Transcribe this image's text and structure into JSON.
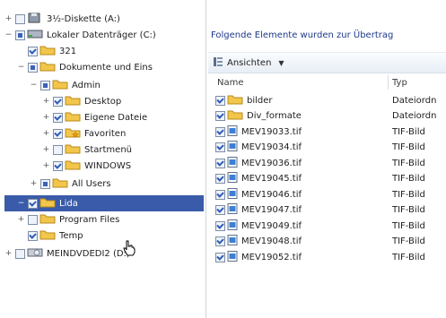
{
  "tree": {
    "items": [
      {
        "label": "3½-Diskette (A:)",
        "expand": "+",
        "check": "none",
        "icon": "floppy-drive-icon"
      },
      {
        "label": "Lokaler Datenträger (C:)",
        "expand": "−",
        "check": "partial",
        "icon": "hard-drive-icon"
      },
      {
        "label": "321",
        "expand": "",
        "check": "checked",
        "icon": "folder-icon"
      },
      {
        "label": "Dokumente und Eins",
        "expand": "−",
        "check": "partial",
        "icon": "folder-icon"
      },
      {
        "label": "Admin",
        "expand": "−",
        "check": "partial",
        "icon": "folder-icon"
      },
      {
        "label": "Desktop",
        "expand": "+",
        "check": "checked",
        "icon": "folder-icon"
      },
      {
        "label": "Eigene Dateie",
        "expand": "+",
        "check": "checked",
        "icon": "folder-icon"
      },
      {
        "label": "Favoriten",
        "expand": "+",
        "check": "checked",
        "icon": "favorites-folder-icon"
      },
      {
        "label": "Startmenü",
        "expand": "+",
        "check": "none",
        "icon": "folder-icon"
      },
      {
        "label": "WINDOWS",
        "expand": "+",
        "check": "checked",
        "icon": "folder-icon"
      },
      {
        "label": "All Users",
        "expand": "+",
        "check": "partial",
        "icon": "folder-icon"
      },
      {
        "label": "Lida",
        "expand": "−",
        "check": "checked",
        "icon": "folder-icon",
        "selected": true
      },
      {
        "label": "Program Files",
        "expand": "+",
        "check": "none",
        "icon": "folder-icon"
      },
      {
        "label": "Temp",
        "expand": "",
        "check": "checked",
        "icon": "folder-icon"
      },
      {
        "label": "MEINDVDEDI2 (D:)",
        "expand": "+",
        "check": "none",
        "icon": "dvd-drive-icon"
      }
    ]
  },
  "content": {
    "notice": "Folgende Elemente wurden zur Übertrag",
    "view_button": "Ansichten",
    "columns": {
      "name": "Name",
      "type": "Typ"
    },
    "files": [
      {
        "name": "bilder",
        "type": "Dateiordn",
        "kind": "folder"
      },
      {
        "name": "Div_formate",
        "type": "Dateiordn",
        "kind": "folder"
      },
      {
        "name": "MEV19033.tif",
        "type": "TIF-Bild",
        "kind": "image"
      },
      {
        "name": "MEV19034.tif",
        "type": "TIF-Bild",
        "kind": "image"
      },
      {
        "name": "MEV19036.tif",
        "type": "TIF-Bild",
        "kind": "image"
      },
      {
        "name": "MEV19045.tif",
        "type": "TIF-Bild",
        "kind": "image"
      },
      {
        "name": "MEV19046.tif",
        "type": "TIF-Bild",
        "kind": "image"
      },
      {
        "name": "MEV19047.tif",
        "type": "TIF-Bild",
        "kind": "image"
      },
      {
        "name": "MEV19049.tif",
        "type": "TIF-Bild",
        "kind": "image"
      },
      {
        "name": "MEV19048.tif",
        "type": "TIF-Bild",
        "kind": "image"
      },
      {
        "name": "MEV19052.tif",
        "type": "TIF-Bild",
        "kind": "image"
      }
    ]
  },
  "colors": {
    "selection": "#3a5ba9",
    "folder": "#f2c64a",
    "checkbox": "#2e5bb8",
    "notice_text": "#1e3a8a"
  }
}
